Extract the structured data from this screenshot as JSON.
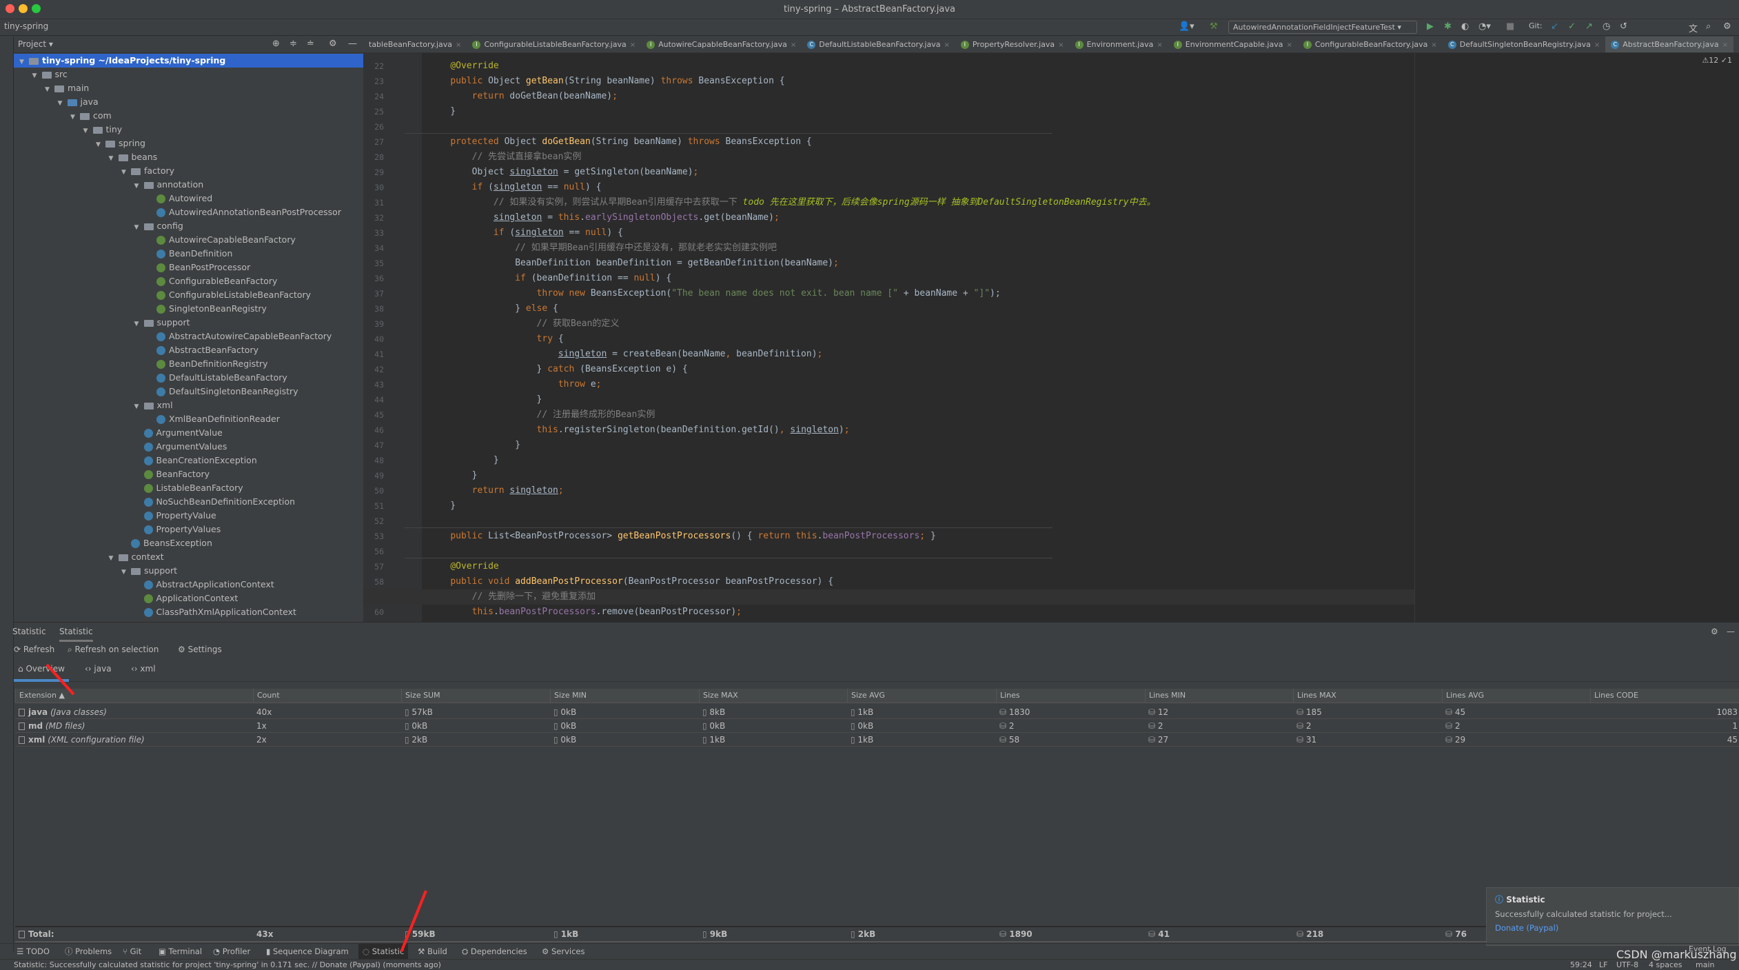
{
  "window": {
    "title": "tiny-spring – AbstractBeanFactory.java",
    "project": "tiny-spring"
  },
  "toolbar": {
    "run_config": "AutowiredAnnotationFieldInjectFeatureTest",
    "git_label": "Git:"
  },
  "editor_tabs": [
    {
      "label": "tableBeanFactory.java",
      "icon": "none"
    },
    {
      "label": "ConfigurableListableBeanFactory.java",
      "icon": "interface-icon"
    },
    {
      "label": "AutowireCapableBeanFactory.java",
      "icon": "interface-icon"
    },
    {
      "label": "DefaultListableBeanFactory.java",
      "icon": "class-icon"
    },
    {
      "label": "PropertyResolver.java",
      "icon": "interface-icon"
    },
    {
      "label": "Environment.java",
      "icon": "interface-icon"
    },
    {
      "label": "EnvironmentCapable.java",
      "icon": "interface-icon"
    },
    {
      "label": "ConfigurableBeanFactory.java",
      "icon": "interface-icon"
    },
    {
      "label": "DefaultSingletonBeanRegistry.java",
      "icon": "class-icon"
    },
    {
      "label": "AbstractBeanFactory.java",
      "icon": "class-icon",
      "active": true
    }
  ],
  "project_panel": {
    "title": "Project",
    "tree": [
      {
        "d": 0,
        "label": "tiny-spring ~/IdeaProjects/tiny-spring",
        "t": "module",
        "sel": true
      },
      {
        "d": 1,
        "label": "src",
        "t": "folder"
      },
      {
        "d": 2,
        "label": "main",
        "t": "folder"
      },
      {
        "d": 3,
        "label": "java",
        "t": "src"
      },
      {
        "d": 4,
        "label": "com",
        "t": "folder"
      },
      {
        "d": 5,
        "label": "tiny",
        "t": "folder"
      },
      {
        "d": 6,
        "label": "spring",
        "t": "folder"
      },
      {
        "d": 7,
        "label": "beans",
        "t": "folder"
      },
      {
        "d": 8,
        "label": "factory",
        "t": "folder"
      },
      {
        "d": 9,
        "label": "annotation",
        "t": "folder"
      },
      {
        "d": 10,
        "label": "Autowired",
        "t": "i"
      },
      {
        "d": 10,
        "label": "AutowiredAnnotationBeanPostProcessor",
        "t": "c"
      },
      {
        "d": 9,
        "label": "config",
        "t": "folder"
      },
      {
        "d": 10,
        "label": "AutowireCapableBeanFactory",
        "t": "i"
      },
      {
        "d": 10,
        "label": "BeanDefinition",
        "t": "c"
      },
      {
        "d": 10,
        "label": "BeanPostProcessor",
        "t": "i"
      },
      {
        "d": 10,
        "label": "ConfigurableBeanFactory",
        "t": "i"
      },
      {
        "d": 10,
        "label": "ConfigurableListableBeanFactory",
        "t": "i"
      },
      {
        "d": 10,
        "label": "SingletonBeanRegistry",
        "t": "i"
      },
      {
        "d": 9,
        "label": "support",
        "t": "folder"
      },
      {
        "d": 10,
        "label": "AbstractAutowireCapableBeanFactory",
        "t": "c"
      },
      {
        "d": 10,
        "label": "AbstractBeanFactory",
        "t": "c"
      },
      {
        "d": 10,
        "label": "BeanDefinitionRegistry",
        "t": "i"
      },
      {
        "d": 10,
        "label": "DefaultListableBeanFactory",
        "t": "c"
      },
      {
        "d": 10,
        "label": "DefaultSingletonBeanRegistry",
        "t": "c"
      },
      {
        "d": 9,
        "label": "xml",
        "t": "folder"
      },
      {
        "d": 10,
        "label": "XmlBeanDefinitionReader",
        "t": "c"
      },
      {
        "d": 9,
        "label": "ArgumentValue",
        "t": "c"
      },
      {
        "d": 9,
        "label": "ArgumentValues",
        "t": "c"
      },
      {
        "d": 9,
        "label": "BeanCreationException",
        "t": "c"
      },
      {
        "d": 9,
        "label": "BeanFactory",
        "t": "i"
      },
      {
        "d": 9,
        "label": "ListableBeanFactory",
        "t": "i"
      },
      {
        "d": 9,
        "label": "NoSuchBeanDefinitionException",
        "t": "c"
      },
      {
        "d": 9,
        "label": "PropertyValue",
        "t": "c"
      },
      {
        "d": 9,
        "label": "PropertyValues",
        "t": "c"
      },
      {
        "d": 8,
        "label": "BeansException",
        "t": "c"
      },
      {
        "d": 7,
        "label": "context",
        "t": "folder"
      },
      {
        "d": 8,
        "label": "support",
        "t": "folder"
      },
      {
        "d": 9,
        "label": "AbstractApplicationContext",
        "t": "c"
      },
      {
        "d": 9,
        "label": "ApplicationContext",
        "t": "i"
      },
      {
        "d": 9,
        "label": "ClassPathXmlApplicationContext",
        "t": "c"
      }
    ]
  },
  "editor": {
    "inspections": "⚠12 ✓1",
    "current_line": "59",
    "lines": [
      {
        "n": "22",
        "t": [
          [
            "    ",
            ""
          ],
          [
            "@Override",
            "an"
          ]
        ]
      },
      {
        "n": "23",
        "t": [
          [
            "    ",
            ""
          ],
          [
            "public ",
            "kw"
          ],
          [
            "Object ",
            ""
          ],
          [
            "getBean",
            "fn"
          ],
          [
            "(String beanName) ",
            ""
          ],
          [
            "throws ",
            "kw"
          ],
          [
            "BeansException {",
            ""
          ]
        ]
      },
      {
        "n": "24",
        "t": [
          [
            "        ",
            ""
          ],
          [
            "return ",
            "kw"
          ],
          [
            "doGetBean(beanName)",
            ""
          ],
          [
            ";",
            "kw"
          ]
        ]
      },
      {
        "n": "25",
        "t": [
          [
            "    }",
            ""
          ]
        ]
      },
      {
        "n": "26",
        "t": []
      },
      {
        "n": "27",
        "t": [
          [
            "    ",
            ""
          ],
          [
            "protected ",
            "kw"
          ],
          [
            "Object ",
            ""
          ],
          [
            "doGetBean",
            "fn"
          ],
          [
            "(String beanName) ",
            ""
          ],
          [
            "throws ",
            "kw"
          ],
          [
            "BeansException {",
            ""
          ]
        ]
      },
      {
        "n": "28",
        "t": [
          [
            "        ",
            ""
          ],
          [
            "// 先尝试直接拿bean实例",
            "cm"
          ]
        ]
      },
      {
        "n": "29",
        "t": [
          [
            "        Object ",
            ""
          ],
          [
            "singleton",
            "ul"
          ],
          [
            " = getSingleton(beanName)",
            ""
          ],
          [
            ";",
            "kw"
          ]
        ]
      },
      {
        "n": "30",
        "t": [
          [
            "        ",
            ""
          ],
          [
            "if ",
            "kw"
          ],
          [
            "(",
            ""
          ],
          [
            "singleton",
            "ul"
          ],
          [
            " == ",
            ""
          ],
          [
            "null",
            "kw"
          ],
          [
            ") {",
            ""
          ]
        ]
      },
      {
        "n": "31",
        "t": [
          [
            "            ",
            ""
          ],
          [
            "// 如果没有实例，则尝试从早期Bean引用缓存中去获取一下 ",
            "cm"
          ],
          [
            "todo 先在这里获取下，后续会像spring源码一样 抽象到DefaultSingletonBeanRegistry中去。",
            "td"
          ]
        ]
      },
      {
        "n": "32",
        "t": [
          [
            "            ",
            ""
          ],
          [
            "singleton",
            "ul"
          ],
          [
            " = ",
            ""
          ],
          [
            "this",
            "kw"
          ],
          [
            ".",
            ""
          ],
          [
            "earlySingletonObjects",
            "fd"
          ],
          [
            ".get(beanName)",
            ""
          ],
          [
            ";",
            "kw"
          ]
        ]
      },
      {
        "n": "33",
        "t": [
          [
            "            ",
            ""
          ],
          [
            "if ",
            "kw"
          ],
          [
            "(",
            ""
          ],
          [
            "singleton",
            "ul"
          ],
          [
            " == ",
            ""
          ],
          [
            "null",
            "kw"
          ],
          [
            ") {",
            ""
          ]
        ]
      },
      {
        "n": "34",
        "t": [
          [
            "                ",
            ""
          ],
          [
            "// 如果早期Bean引用缓存中还是没有，那就老老实实创建实例吧",
            "cm"
          ]
        ]
      },
      {
        "n": "35",
        "t": [
          [
            "                BeanDefinition beanDefinition = getBeanDefinition(beanName)",
            ""
          ],
          [
            ";",
            "kw"
          ]
        ]
      },
      {
        "n": "36",
        "t": [
          [
            "                ",
            ""
          ],
          [
            "if ",
            "kw"
          ],
          [
            "(beanDefinition == ",
            ""
          ],
          [
            "null",
            "kw"
          ],
          [
            ") {",
            ""
          ]
        ]
      },
      {
        "n": "37",
        "t": [
          [
            "                    ",
            ""
          ],
          [
            "throw new ",
            "kw"
          ],
          [
            "BeansException(",
            ""
          ],
          [
            "\"The bean name does not exit. bean name [\"",
            "st"
          ],
          [
            " + beanName + ",
            ""
          ],
          [
            "\"]\"",
            "st"
          ],
          [
            ");",
            ""
          ]
        ]
      },
      {
        "n": "38",
        "t": [
          [
            "                } ",
            ""
          ],
          [
            "else ",
            "kw"
          ],
          [
            "{",
            ""
          ]
        ]
      },
      {
        "n": "39",
        "t": [
          [
            "                    ",
            ""
          ],
          [
            "// 获取Bean的定义",
            "cm"
          ]
        ]
      },
      {
        "n": "40",
        "t": [
          [
            "                    ",
            ""
          ],
          [
            "try ",
            "kw"
          ],
          [
            "{",
            ""
          ]
        ]
      },
      {
        "n": "41",
        "t": [
          [
            "                        ",
            ""
          ],
          [
            "singleton",
            "ul"
          ],
          [
            " = createBean(beanName",
            ""
          ],
          [
            ", ",
            "kw"
          ],
          [
            "beanDefinition)",
            ""
          ],
          [
            ";",
            "kw"
          ]
        ]
      },
      {
        "n": "42",
        "t": [
          [
            "                    } ",
            ""
          ],
          [
            "catch ",
            "kw"
          ],
          [
            "(BeansException e) {",
            ""
          ]
        ]
      },
      {
        "n": "43",
        "t": [
          [
            "                        ",
            ""
          ],
          [
            "throw ",
            "kw"
          ],
          [
            "e",
            ""
          ],
          [
            ";",
            "kw"
          ]
        ]
      },
      {
        "n": "44",
        "t": [
          [
            "                    }",
            ""
          ]
        ]
      },
      {
        "n": "45",
        "t": [
          [
            "                    ",
            ""
          ],
          [
            "// 注册最终成形的Bean实例",
            "cm"
          ]
        ]
      },
      {
        "n": "46",
        "t": [
          [
            "                    ",
            ""
          ],
          [
            "this",
            "kw"
          ],
          [
            ".registerSingleton(beanDefinition.getId()",
            ""
          ],
          [
            ", ",
            "kw"
          ],
          [
            "singleton",
            "ul"
          ],
          [
            ")",
            ""
          ],
          [
            ";",
            "kw"
          ]
        ]
      },
      {
        "n": "47",
        "t": [
          [
            "                }",
            ""
          ]
        ]
      },
      {
        "n": "48",
        "t": [
          [
            "            }",
            ""
          ]
        ]
      },
      {
        "n": "49",
        "t": [
          [
            "        }",
            ""
          ]
        ]
      },
      {
        "n": "50",
        "t": [
          [
            "        ",
            ""
          ],
          [
            "return ",
            "kw"
          ],
          [
            "singleton",
            "ul"
          ],
          [
            ";",
            "kw"
          ]
        ]
      },
      {
        "n": "51",
        "t": [
          [
            "    }",
            ""
          ]
        ]
      },
      {
        "n": "52",
        "t": []
      },
      {
        "n": "53",
        "t": [
          [
            "    ",
            ""
          ],
          [
            "public ",
            "kw"
          ],
          [
            "List<BeanPostProcessor> ",
            ""
          ],
          [
            "getBeanPostProcessors",
            "fn"
          ],
          [
            "() { ",
            ""
          ],
          [
            "return this",
            "kw"
          ],
          [
            ".",
            ""
          ],
          [
            "beanPostProcessors",
            "fd"
          ],
          [
            "; ",
            "kw"
          ],
          [
            "}",
            ""
          ]
        ]
      },
      {
        "n": "56",
        "t": []
      },
      {
        "n": "57",
        "t": [
          [
            "    ",
            ""
          ],
          [
            "@Override",
            "an"
          ]
        ]
      },
      {
        "n": "58",
        "t": [
          [
            "    ",
            ""
          ],
          [
            "public void ",
            "kw"
          ],
          [
            "addBeanPostProcessor",
            "fn"
          ],
          [
            "(BeanPostProcessor beanPostProcessor) {",
            ""
          ]
        ]
      },
      {
        "n": "59",
        "t": [
          [
            "        ",
            ""
          ],
          [
            "// 先删除一下，避免重复添加",
            "cm"
          ]
        ]
      },
      {
        "n": "60",
        "t": [
          [
            "        ",
            ""
          ],
          [
            "this",
            "kw"
          ],
          [
            ".",
            ""
          ],
          [
            "beanPostProcessors",
            "fd"
          ],
          [
            ".remove(beanPostProcessor)",
            ""
          ],
          [
            ";",
            "kw"
          ]
        ]
      }
    ]
  },
  "statistic": {
    "tabs": [
      "Statistic",
      "Statistic"
    ],
    "refresh": "Refresh",
    "refresh_selection": "Refresh on selection",
    "settings": "Settings",
    "subtabs": [
      "Overview",
      "java",
      "xml"
    ],
    "columns": [
      "Extension ▲",
      "Count",
      "Size SUM",
      "Size MIN",
      "Size MAX",
      "Size AVG",
      "Lines",
      "Lines MIN",
      "Lines MAX",
      "Lines AVG",
      "Lines CODE"
    ],
    "rows": [
      {
        "ext": "java",
        "desc": "(Java classes)",
        "vals": [
          "40x",
          "57kB",
          "0kB",
          "8kB",
          "1kB",
          "1830",
          "12",
          "185",
          "45",
          "1083"
        ]
      },
      {
        "ext": "md",
        "desc": "(MD files)",
        "vals": [
          "1x",
          "0kB",
          "0kB",
          "0kB",
          "0kB",
          "2",
          "2",
          "2",
          "2",
          "1"
        ]
      },
      {
        "ext": "xml",
        "desc": "(XML configuration file)",
        "vals": [
          "2x",
          "2kB",
          "0kB",
          "1kB",
          "1kB",
          "58",
          "27",
          "31",
          "29",
          "45"
        ]
      }
    ],
    "total_label": "Total:",
    "totals": [
      "43x",
      "59kB",
      "1kB",
      "9kB",
      "2kB",
      "1890",
      "41",
      "218",
      "76"
    ]
  },
  "notification": {
    "title": "Statistic",
    "body": "Successfully calculated statistic for project...",
    "link": "Donate (Paypal)"
  },
  "tool_windows": [
    "TODO",
    "Problems",
    "Git",
    "Terminal",
    "Profiler",
    "Sequence Diagram",
    "Statistic",
    "Build",
    "Dependencies",
    "Services"
  ],
  "event_log": "Event Log",
  "status": {
    "message": "Statistic: Successfully calculated statistic for project 'tiny-spring' in 0.171 sec. // Donate (Paypal) (moments ago)",
    "position": "59:24",
    "line_sep": "LF",
    "encoding": "UTF-8",
    "indent": "4 spaces",
    "branch": "main"
  },
  "watermark": "CSDN @markuszhang",
  "colors": {
    "selection": "#2f65ca",
    "keyword": "#cc7832",
    "annotation_arrow": "#ff2020",
    "link": "#589df6"
  }
}
